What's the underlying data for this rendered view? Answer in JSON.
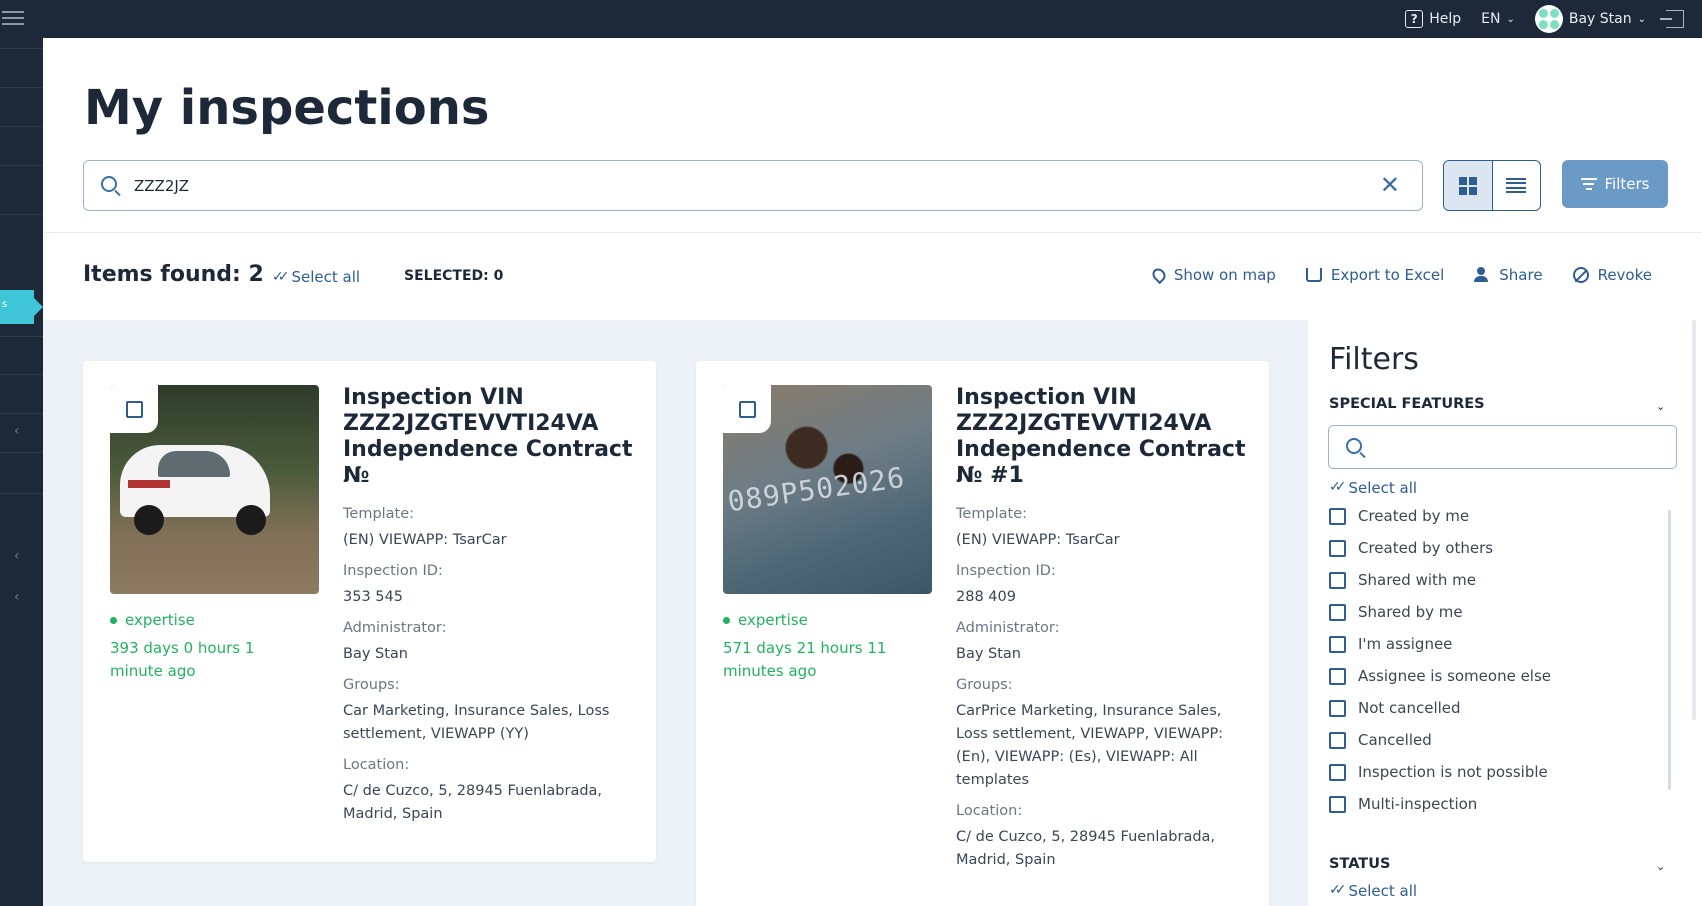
{
  "topbar": {
    "help_label": "Help",
    "lang": "EN",
    "user_name": "Bay Stan"
  },
  "page": {
    "title": "My inspections"
  },
  "search": {
    "value": "ZZZ2JZ"
  },
  "filters_button": "Filters",
  "toolbar": {
    "items_found": "Items found: 2",
    "select_all": "Select all",
    "selected": "SELECTED: 0",
    "show_on_map": "Show on map",
    "export_excel": "Export to Excel",
    "share": "Share",
    "revoke": "Revoke"
  },
  "cards": [
    {
      "title": "Inspection VIN ZZZ2JZGTEVVTI24VA Independence Contract №",
      "status": "expertise",
      "time_ago": "393 days 0 hours 1 minute ago",
      "template_label": "Template:",
      "template": "(EN) VIEWAPP: TsarCar",
      "id_label": "Inspection ID:",
      "inspection_id": "353 545",
      "admin_label": "Administrator:",
      "admin": "Bay Stan",
      "groups_label": "Groups:",
      "groups": "Car Marketing, Insurance Sales, Loss settlement, VIEWAPP (YY)",
      "location_label": "Location:",
      "location": "C/ de Cuzco, 5, 28945 Fuenlabrada, Madrid, Spain"
    },
    {
      "title": "Inspection VIN ZZZ2JZGTEVVTI24VA Independence Contract № #1",
      "status": "expertise",
      "time_ago": "571 days 21 hours 11 minutes ago",
      "template_label": "Template:",
      "template": "(EN) VIEWAPP: TsarCar",
      "id_label": "Inspection ID:",
      "inspection_id": "288 409",
      "admin_label": "Administrator:",
      "admin": "Bay Stan",
      "groups_label": "Groups:",
      "groups": "CarPrice Marketing, Insurance Sales, Loss settlement, VIEWAPP, VIEWAPP: (En), VIEWAPP: (Es), VIEWAPP: All templates",
      "location_label": "Location:",
      "location": "C/ de Cuzco, 5, 28945 Fuenlabrada, Madrid, Spain",
      "photo_text": "089P502026"
    }
  ],
  "filters_panel": {
    "title": "Filters",
    "special_features": "SPECIAL FEATURES",
    "select_all": "Select all",
    "items": [
      "Created by me",
      "Created by others",
      "Shared with me",
      "Shared by me",
      "I'm assignee",
      "Assignee is someone else",
      "Not cancelled",
      "Cancelled",
      "Inspection is not possible",
      "Multi-inspection"
    ],
    "status_section": "STATUS",
    "status_select_all": "Select all"
  }
}
